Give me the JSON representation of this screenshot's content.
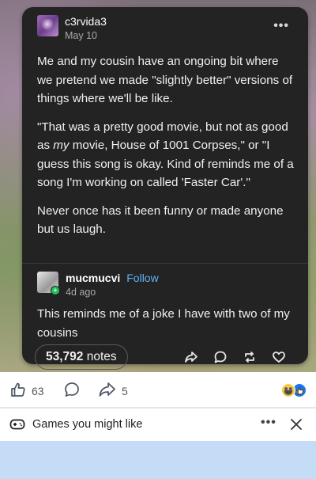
{
  "post": {
    "username": "c3rvida3",
    "date": "May 10",
    "more": "•••",
    "paragraph1": "Me and my cousin have an ongoing bit where we pretend we made \"slightly better\" versions of things where we'll be like.",
    "p2_a": "\"That was a pretty good movie, but not as good as ",
    "p2_em": "my",
    "p2_b": " movie, House of 1001 Corpses,\" or \"I guess this song is okay. Kind of reminds me of a song I'm working on called 'Faster Car'.\"",
    "paragraph3": "Never once has it been funny or made anyone but us laugh."
  },
  "reply": {
    "username": "mucmucvi",
    "follow": "Follow",
    "date": "4d ago",
    "body": "This reminds me of a joke I have with two of my cousins"
  },
  "notes": {
    "count": "53,792",
    "label": "notes"
  },
  "post_actions": [
    "share-icon",
    "reply-icon",
    "reblog-icon",
    "heart-icon"
  ],
  "fb": {
    "likes": "63",
    "shares": "5",
    "reactions": [
      "haha",
      "like"
    ]
  },
  "games": {
    "title": "Games you might like",
    "more": "•••"
  },
  "colors": {
    "card_bg": "#232323",
    "follow": "#5fb3f5",
    "fb_blue": "#1877f2",
    "panel_blue": "#c4dcf6"
  }
}
